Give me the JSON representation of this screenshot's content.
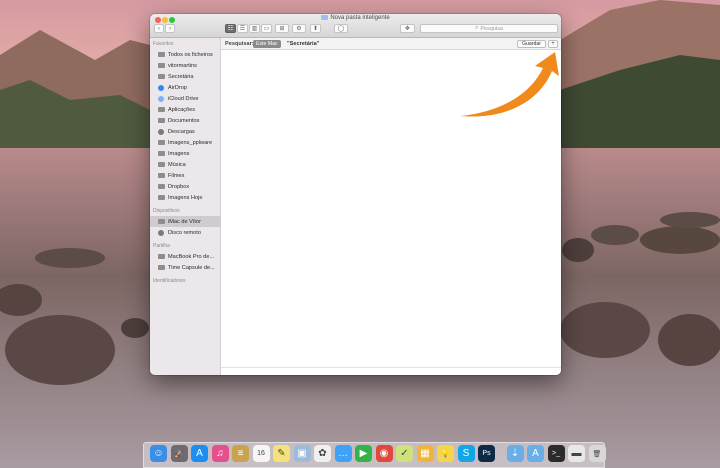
{
  "window": {
    "title": "Nova pasta inteligente",
    "search_placeholder": "Pesquisa"
  },
  "toolbar": {
    "back": "‹",
    "forward": "›",
    "view_icons": "☷",
    "view_list": "☰",
    "view_columns": "▥",
    "view_coverflow": "▭",
    "arrange": "⊞",
    "action": "⚙",
    "share": "⬆",
    "tags": "◯",
    "dropbox": "❖"
  },
  "sidebar": {
    "sections": [
      {
        "title": "Favoritos",
        "items": [
          {
            "label": "Todos os ficheiros",
            "icon": "all-files-icon"
          },
          {
            "label": "vitormartins",
            "icon": "home-icon"
          },
          {
            "label": "Secretária",
            "icon": "desktop-icon"
          },
          {
            "label": "AirDrop",
            "icon": "airdrop-icon"
          },
          {
            "label": "iCloud Drive",
            "icon": "icloud-icon"
          },
          {
            "label": "Aplicações",
            "icon": "applications-icon"
          },
          {
            "label": "Documentos",
            "icon": "documents-icon"
          },
          {
            "label": "Descargas",
            "icon": "downloads-icon"
          },
          {
            "label": "Imagens_pplware",
            "icon": "folder-icon"
          },
          {
            "label": "Imagens",
            "icon": "pictures-icon"
          },
          {
            "label": "Música",
            "icon": "music-icon"
          },
          {
            "label": "Filmes",
            "icon": "movies-icon"
          },
          {
            "label": "Dropbox",
            "icon": "dropbox-icon"
          },
          {
            "label": "Imagens Hoje",
            "icon": "folder-icon"
          }
        ]
      },
      {
        "title": "Dispositivos",
        "items": [
          {
            "label": "iMac de Vítor",
            "icon": "imac-icon",
            "selected": true
          },
          {
            "label": "Disco remoto",
            "icon": "remote-disc-icon"
          }
        ]
      },
      {
        "title": "Partilha",
        "items": [
          {
            "label": "MacBook Pro de...",
            "icon": "computer-icon"
          },
          {
            "label": "Time Capsule de...",
            "icon": "time-capsule-icon"
          }
        ]
      },
      {
        "title": "Identificadores",
        "items": []
      }
    ]
  },
  "searchbar": {
    "label": "Pesquisar:",
    "scope": "Este Mac",
    "term": "\"Secretária\"",
    "save_label": "Guardar",
    "add_label": "+"
  },
  "colors": {
    "arrow": "#f08a1c",
    "selection": "#cfcbd0",
    "sidebar_bg": "#ebe7ea"
  },
  "dock": {
    "icons": [
      {
        "name": "finder-icon",
        "color": "#3a8ee6",
        "glyph": "☺"
      },
      {
        "name": "launchpad-icon",
        "color": "#6c6c70",
        "glyph": "🚀"
      },
      {
        "name": "app-store-icon",
        "color": "#1d8ef0",
        "glyph": "A"
      },
      {
        "name": "itunes-icon",
        "color": "#e4508c",
        "glyph": "♫"
      },
      {
        "name": "notes-app-icon",
        "color": "#c9a44a",
        "glyph": "≡"
      },
      {
        "name": "calendar-icon",
        "color": "#f5f5f5",
        "glyph": "16"
      },
      {
        "name": "notes-icon",
        "color": "#f3e37a",
        "glyph": "✎"
      },
      {
        "name": "preview-icon",
        "color": "#9bbbd9",
        "glyph": "▣"
      },
      {
        "name": "photos-icon",
        "color": "#f0f0f0",
        "glyph": "✿"
      },
      {
        "name": "messages-icon",
        "color": "#3fa2f6",
        "glyph": "…"
      },
      {
        "name": "facetime-icon",
        "color": "#34b34b",
        "glyph": "▶"
      },
      {
        "name": "chrome-icon",
        "color": "#e0483a",
        "glyph": "◉"
      },
      {
        "name": "vectorize-icon",
        "color": "#cfe27a",
        "glyph": "✓"
      },
      {
        "name": "grid-app-icon",
        "color": "#f0b43a",
        "glyph": "▦"
      },
      {
        "name": "tips-icon",
        "color": "#f6d54a",
        "glyph": "💡"
      },
      {
        "name": "skype-icon",
        "color": "#12a6e6",
        "glyph": "S"
      },
      {
        "name": "photoshop-icon",
        "color": "#0e2a45",
        "glyph": "Ps"
      },
      {
        "name": "folder-downloads-icon",
        "color": "#6aaee8",
        "glyph": "⇣"
      },
      {
        "name": "folder-applications-icon",
        "color": "#6aaee8",
        "glyph": "A"
      },
      {
        "name": "terminal-icon",
        "color": "#2b2b2b",
        "glyph": ">_"
      },
      {
        "name": "external-drive-icon",
        "color": "#e8e8e8",
        "glyph": "▬"
      },
      {
        "name": "trash-icon",
        "color": "#d8d8d8",
        "glyph": "🗑"
      }
    ]
  }
}
